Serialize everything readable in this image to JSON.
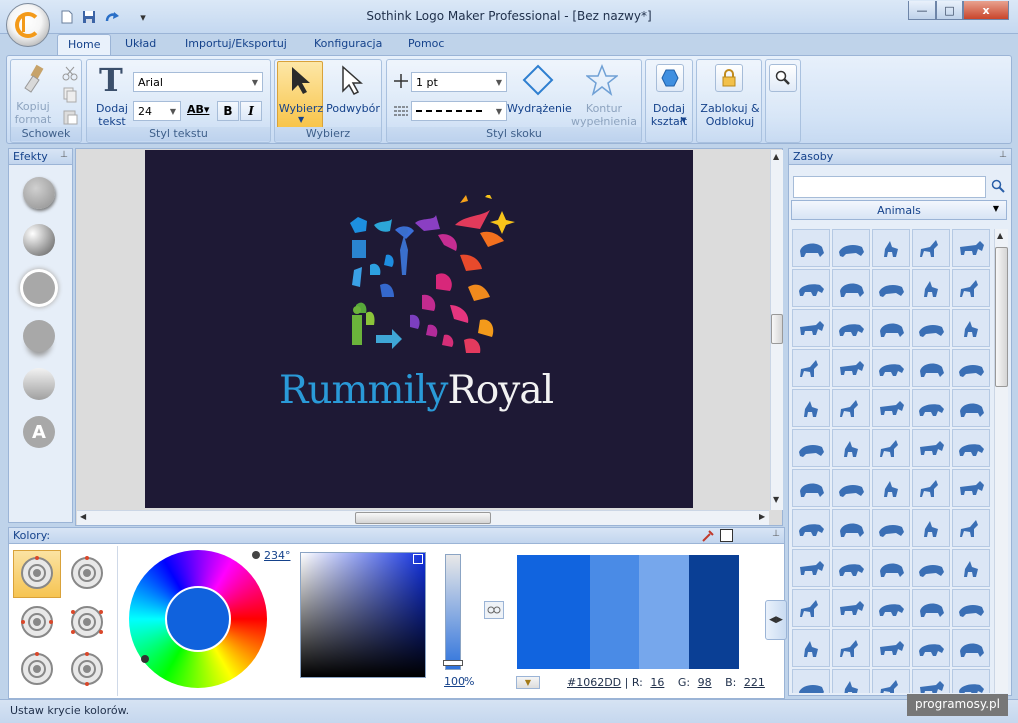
{
  "window": {
    "title": "Sothink Logo Maker Professional - [Bez nazwy*]",
    "min": "—",
    "max": "□",
    "close": "x"
  },
  "tabs": [
    "Home",
    "Układ",
    "Importuj/Eksportuj",
    "Konfiguracja",
    "Pomoc"
  ],
  "ribbon": {
    "clipboard": {
      "copy_format": "Kopiuj\nformat",
      "label": "Schowek"
    },
    "text": {
      "add_text": "Dodaj\ntekst",
      "font": "Arial",
      "size": "24",
      "bold": "B",
      "italic": "I",
      "label": "Styl tekstu"
    },
    "select": {
      "select": "Wybierz",
      "subselect": "Podwybór",
      "label": "Wybierz"
    },
    "stroke": {
      "width": "1 pt",
      "highlight": "Wydrążenie",
      "fill_outline": "Kontur\nwypełnienia",
      "label": "Styl skoku"
    },
    "add_shape": "Dodaj\nkształt",
    "lock": "Zablokuj &\nOdblokuj"
  },
  "effects": {
    "title": "Efekty"
  },
  "canvas": {
    "logo_part1": "Rummily",
    "logo_part2": "Royal",
    "bg_color": "#1e1935"
  },
  "assets": {
    "title": "Zasoby",
    "search_placeholder": "",
    "category": "Animals"
  },
  "colors": {
    "title": "Kolory:",
    "hue": "234°",
    "alpha": "100",
    "alpha_unit": "%",
    "hex": "#1062DD",
    "r_label": "R:",
    "r": "16",
    "g_label": "G:",
    "g": "98",
    "b_label": "B:",
    "b": "221",
    "swatches": [
      "#1164df",
      "#4a8be6",
      "#76a7ec",
      "#0a3f95"
    ],
    "wheel_center": "#1062DD"
  },
  "status": "Ustaw krycie kolorów.",
  "watermark": "programosy.pl"
}
